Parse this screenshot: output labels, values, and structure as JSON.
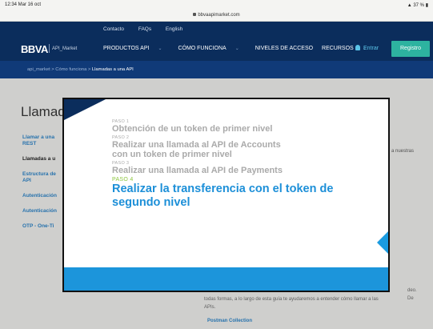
{
  "status_bar": {
    "time": "12:34  Mar 16 oct",
    "battery": "37 %"
  },
  "browser": {
    "url": "bbvaapimarket.com"
  },
  "header": {
    "top_links": [
      "Contacto",
      "FAQs",
      "English"
    ],
    "logo": "BBVA",
    "logo_sub": "API_Market",
    "nav": [
      "PRODUCTOS API",
      "CÓMO FUNCIONA",
      "NIVELES DE ACCESO",
      "RECURSOS"
    ],
    "login": "Entrar",
    "register": "Registro"
  },
  "breadcrumb": [
    "api_market",
    "Cómo funciona",
    "Llamadas a una API"
  ],
  "page": {
    "title": "Llamad",
    "sidebar": [
      "Llamar a una REST",
      "Llamadas a u",
      "Estructura de API",
      "Autenticación",
      "Autenticación",
      "OTP - One-Ti"
    ],
    "right_snippet": "a nuestras",
    "body_lines": [
      "todas formas, a lo largo de esta guía te ayudaremos a entender cómo llamar a las",
      "APIs."
    ],
    "body_end": "deo. De",
    "link": "Postman Collection"
  },
  "modal": {
    "steps": [
      {
        "label": "PASO 1",
        "text": "Obtención de un token de primer nivel"
      },
      {
        "label": "PASO 2",
        "text": "Realizar una llamada al API de Accounts con un token de primer nivel"
      },
      {
        "label": "PASO 3",
        "text": "Realizar una llamada al API de Payments"
      },
      {
        "label": "PASO 4",
        "text": "Realizar la transferencia con el token de segundo nivel"
      }
    ],
    "colors": {
      "inactive": "#aaaaaa",
      "active_label": "#8dc63f",
      "active_text": "#1c8fd8",
      "accent": "#1c95db"
    }
  }
}
